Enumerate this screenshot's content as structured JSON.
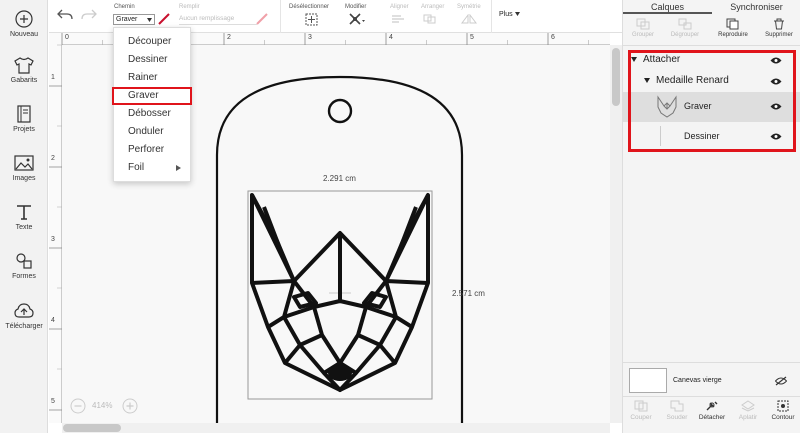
{
  "sidebar": {
    "items": [
      {
        "label": "Nouveau",
        "icon": "plus-circle-icon"
      },
      {
        "label": "Gabarits",
        "icon": "shirt-icon"
      },
      {
        "label": "Projets",
        "icon": "notebook-icon"
      },
      {
        "label": "Images",
        "icon": "image-icon"
      },
      {
        "label": "Texte",
        "icon": "text-t-icon"
      },
      {
        "label": "Formes",
        "icon": "shapes-icon"
      },
      {
        "label": "Télécharger",
        "icon": "cloud-upload-icon"
      }
    ]
  },
  "toolbar": {
    "chemin_label": "Chemin",
    "chemin_value": "Graver",
    "remplir_label": "Remplir",
    "remplir_value": "Aucun remplissage",
    "deselect_label": "Désélectionner",
    "modifier_label": "Modifier",
    "aligner_label": "Aligner",
    "arranger_label": "Arranger",
    "symetrie_label": "Symétrie",
    "plus_label": "Plus"
  },
  "ruler": {
    "h_numbers": [
      "0",
      "1",
      "2",
      "3",
      "4",
      "5",
      "6"
    ],
    "v_numbers": [
      "1",
      "2",
      "3",
      "4",
      "5"
    ]
  },
  "menu": {
    "items": [
      {
        "label": "Découper"
      },
      {
        "label": "Dessiner"
      },
      {
        "label": "Rainer"
      },
      {
        "label": "Graver",
        "selected": true
      },
      {
        "label": "Débosser"
      },
      {
        "label": "Onduler"
      },
      {
        "label": "Perforer"
      },
      {
        "label": "Foil",
        "has_submenu": true
      }
    ]
  },
  "canvas": {
    "width_dim": "2.291 cm",
    "height_dim": "2.571 cm",
    "zoom": "414%"
  },
  "panel": {
    "tab_calques": "Calques",
    "tab_sync": "Synchroniser",
    "actions": {
      "grouper": "Grouper",
      "degrouper": "Dégrouper",
      "reproduire": "Reproduire",
      "supprimer": "Supprimer"
    },
    "layers": {
      "attacher": "Attacher",
      "group": "Medaille Renard",
      "graver": "Graver",
      "dessiner": "Dessiner"
    },
    "blank_canvas": "Canevas vierge",
    "bottom_actions": {
      "couper": "Couper",
      "souder": "Souder",
      "detacher": "Détacher",
      "aplatir": "Aplatir",
      "contour": "Contour"
    }
  },
  "colors": {
    "highlight": "#e0141b",
    "line_color": "#c8102e"
  }
}
